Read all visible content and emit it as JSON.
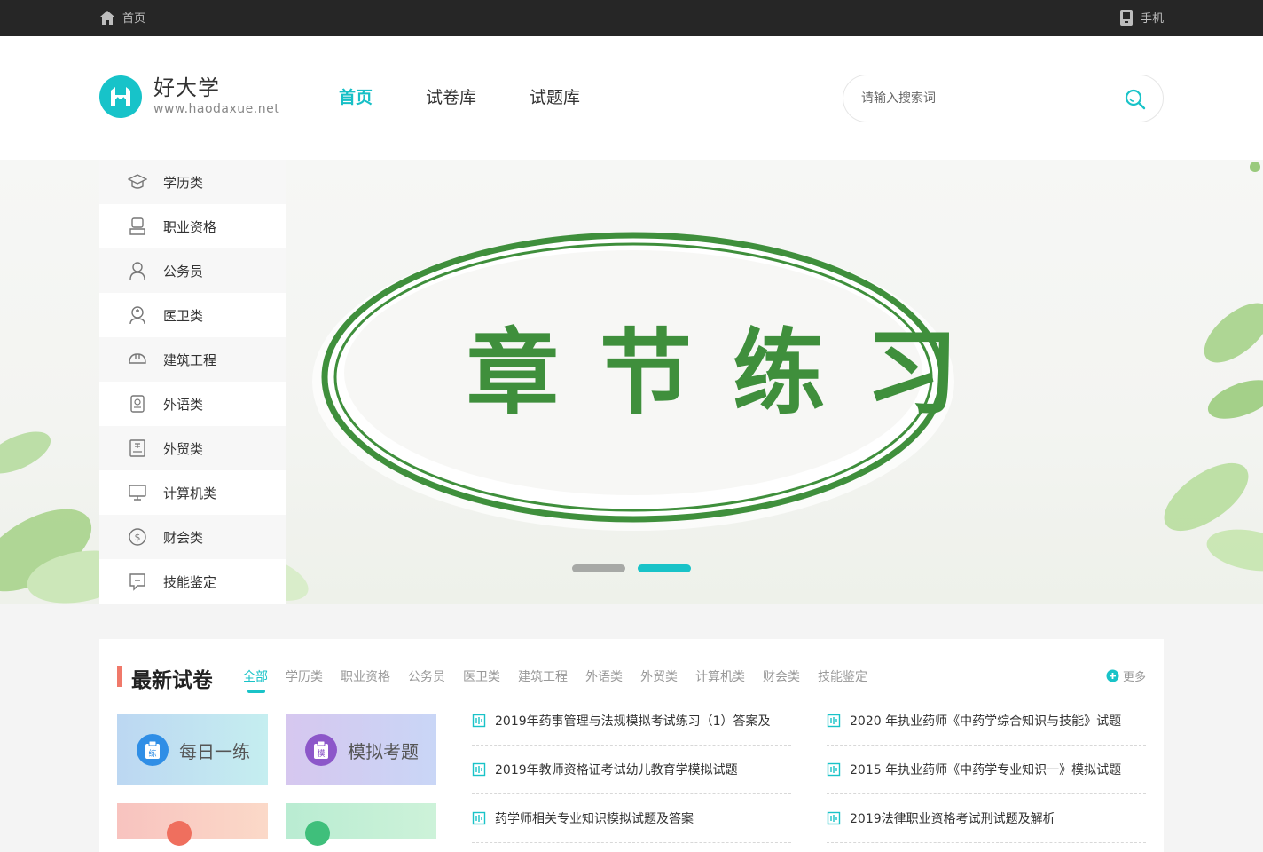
{
  "topbar": {
    "home_label": "首页",
    "phone_label": "手机"
  },
  "header": {
    "site_name": "好大学",
    "site_url": "www.haodaxue.net",
    "nav": [
      {
        "label": "首页",
        "active": true
      },
      {
        "label": "试卷库",
        "active": false
      },
      {
        "label": "试题库",
        "active": false
      }
    ],
    "search_placeholder": "请输入搜索词"
  },
  "sidebar": {
    "items": [
      {
        "label": "学历类",
        "icon": "graduation-cap-icon"
      },
      {
        "label": "职业资格",
        "icon": "id-badge-icon"
      },
      {
        "label": "公务员",
        "icon": "user-icon"
      },
      {
        "label": "医卫类",
        "icon": "nurse-icon"
      },
      {
        "label": "建筑工程",
        "icon": "helmet-icon"
      },
      {
        "label": "外语类",
        "icon": "certificate-icon"
      },
      {
        "label": "外贸类",
        "icon": "ledger-icon"
      },
      {
        "label": "计算机类",
        "icon": "monitor-icon"
      },
      {
        "label": "财会类",
        "icon": "coin-icon"
      },
      {
        "label": "技能鉴定",
        "icon": "chat-box-icon"
      }
    ]
  },
  "banner": {
    "title": "章节练习",
    "slides": 2,
    "active_slide": 2,
    "accent": "#19c3c8",
    "title_color": "#3f8f3c"
  },
  "latest": {
    "title": "最新试卷",
    "tabs": [
      "全部",
      "学历类",
      "职业资格",
      "公务员",
      "医卫类",
      "建筑工程",
      "外语类",
      "外贸类",
      "计算机类",
      "财会类",
      "技能鉴定"
    ],
    "active_tab": "全部",
    "more_label": "更多",
    "cards": [
      {
        "label": "每日一练",
        "badge": "练"
      },
      {
        "label": "模拟考题",
        "badge": "模"
      }
    ],
    "left_list": [
      "2019年药事管理与法规模拟考试练习（1）答案及",
      "2019年教师资格证考试幼儿教育学模拟试题",
      "药学师相关专业知识模拟试题及答案"
    ],
    "right_list": [
      "2020 年执业药师《中药学综合知识与技能》试题",
      "2015 年执业药师《中药学专业知识一》模拟试题",
      "2019法律职业资格考试刑试题及解析"
    ]
  }
}
